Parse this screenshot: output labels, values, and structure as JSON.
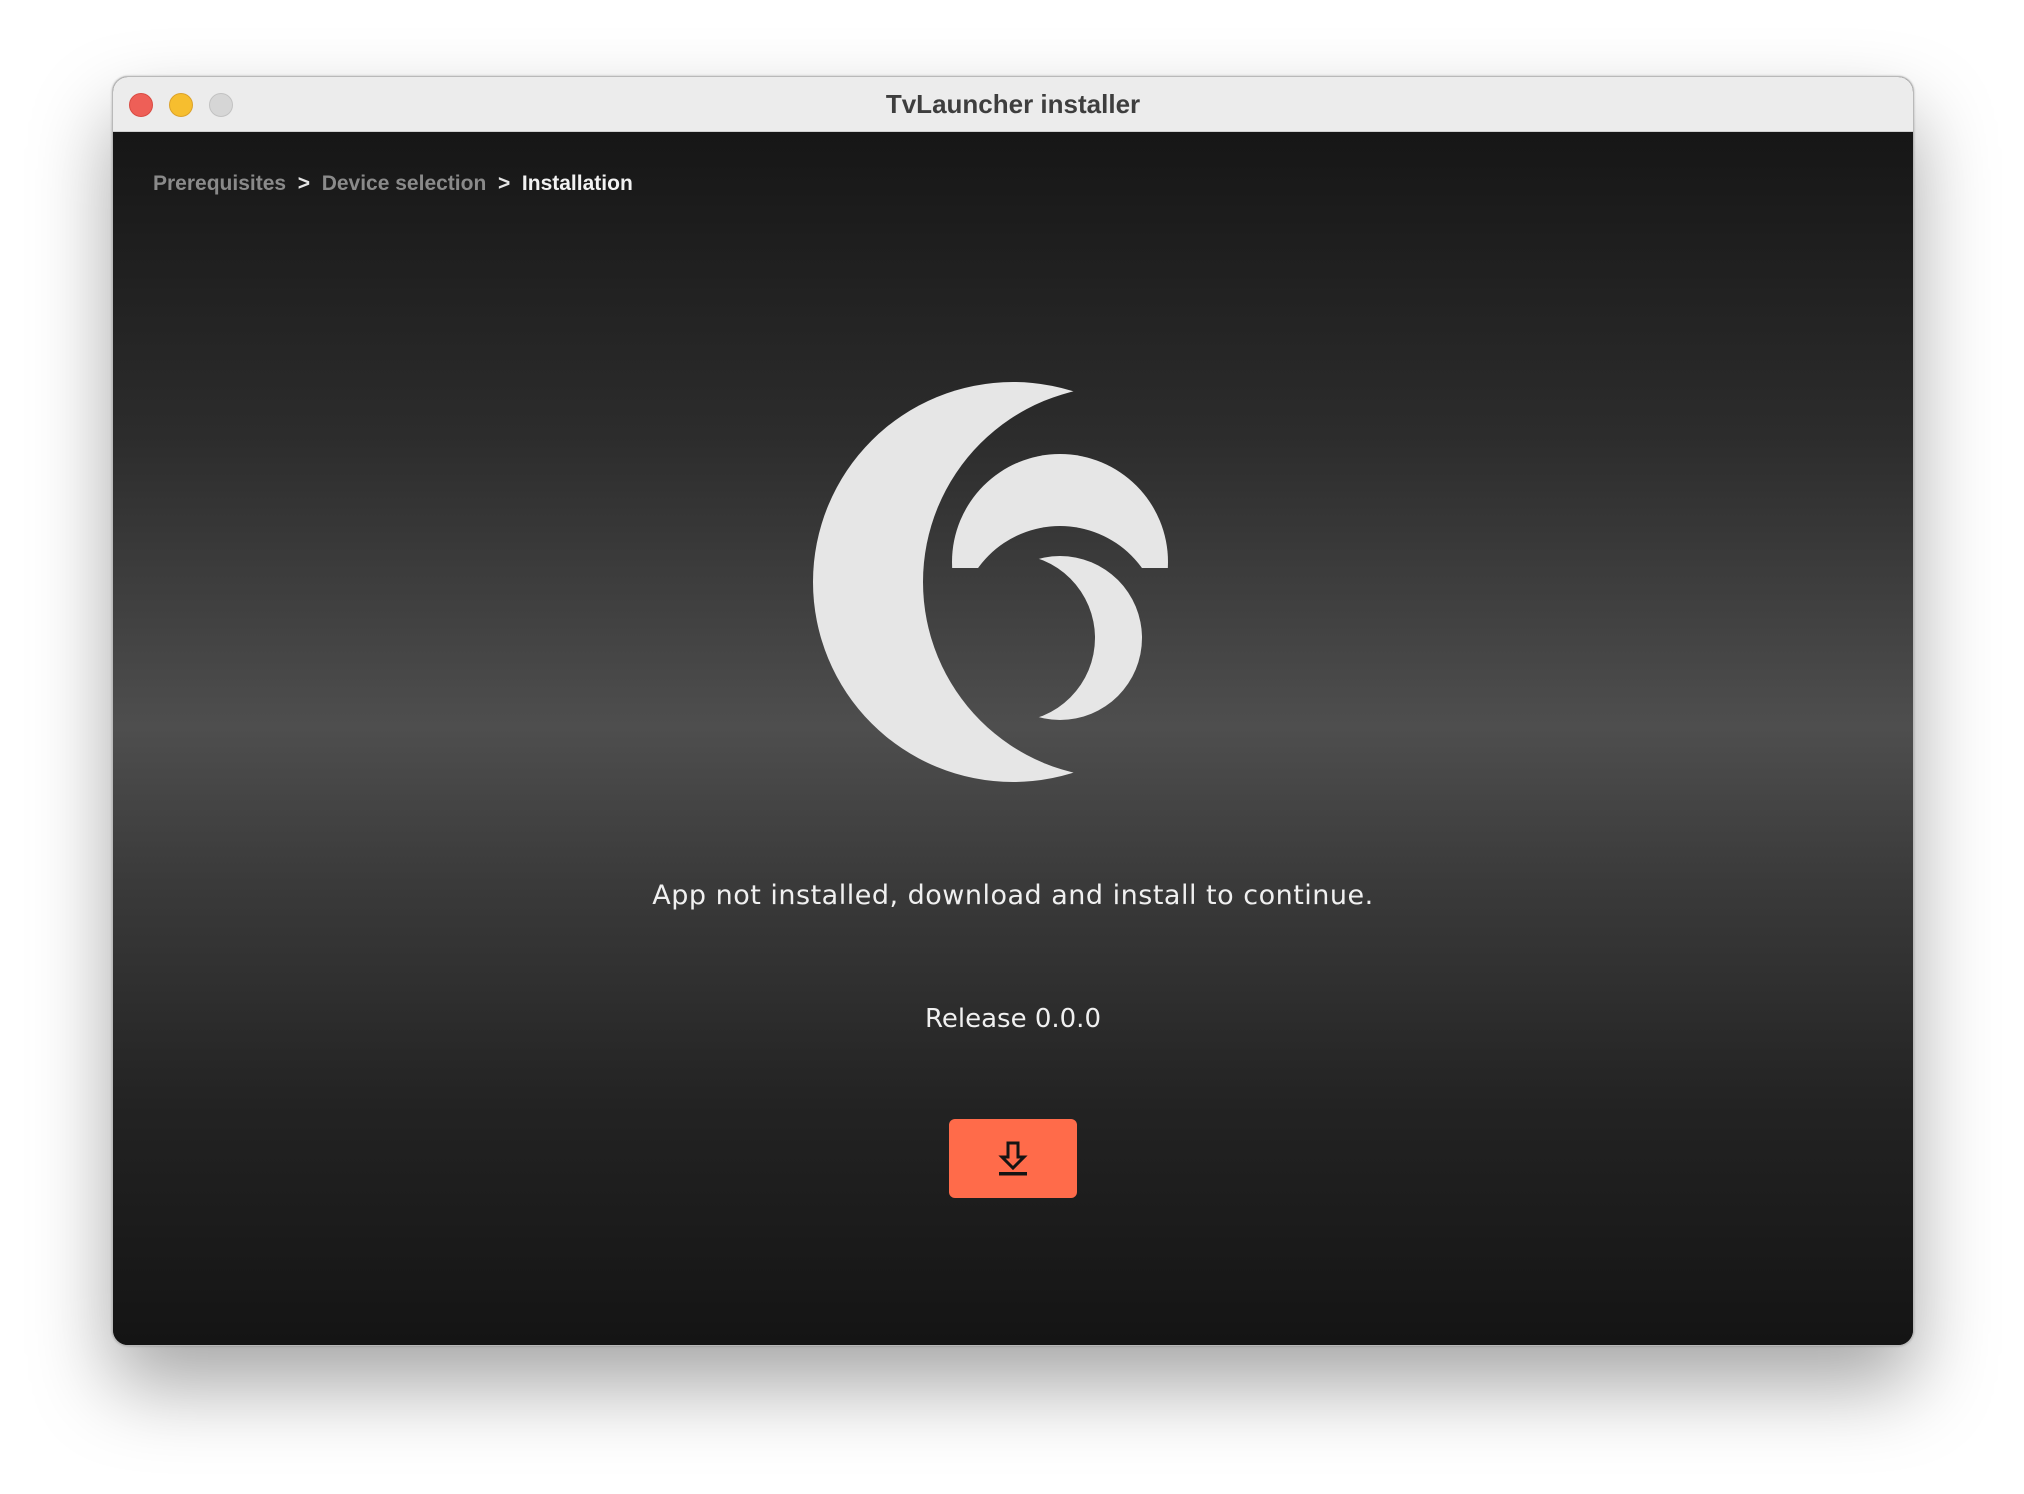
{
  "window": {
    "title": "TvLauncher installer"
  },
  "breadcrumb": {
    "items": [
      {
        "label": "Prerequisites",
        "state": "done"
      },
      {
        "label": "Device selection",
        "state": "done"
      },
      {
        "label": "Installation",
        "state": "current"
      }
    ],
    "separator": ">"
  },
  "main": {
    "logo_icon": "app-logo-crescent-icon",
    "message": "App not installed, download and install to continue.",
    "release_label": "Release 0.0.0",
    "download_button_icon": "download-icon"
  },
  "colors": {
    "accent": "#ff6b4a",
    "logo": "#e6e6e6"
  }
}
